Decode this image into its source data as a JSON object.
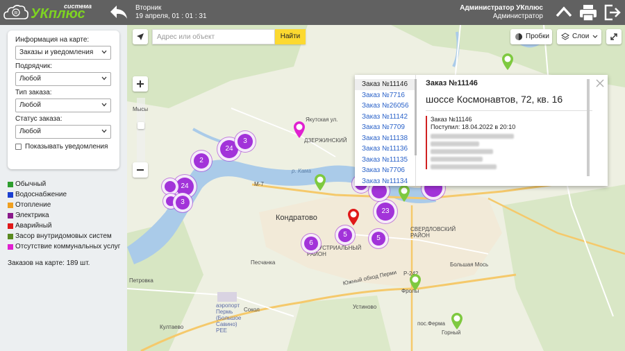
{
  "header": {
    "logo_top": "система",
    "logo_main": "УКплюс",
    "weekday": "Вторник",
    "datetime": "19 апреля, 01 : 01 : 31",
    "user_name": "Администратор УКплюс",
    "user_role": "Администратор"
  },
  "filters": {
    "info_label": "Информация на карте:",
    "info_value": "Заказы и уведомления",
    "contractor_label": "Подрядчик:",
    "contractor_value": "Любой",
    "type_label": "Тип заказа:",
    "type_value": "Любой",
    "status_label": "Статус заказа:",
    "status_value": "Любой",
    "show_notifications": "Показывать уведомления"
  },
  "legend": [
    {
      "label": "Обычный",
      "color": "#2e9e2e"
    },
    {
      "label": "Водоснабжение",
      "color": "#1a3fd1"
    },
    {
      "label": "Отопление",
      "color": "#f0a020"
    },
    {
      "label": "Электрика",
      "color": "#8a1a8a"
    },
    {
      "label": "Аварийный",
      "color": "#e01818"
    },
    {
      "label": "Засор внутридомовых систем",
      "color": "#5a8a20"
    },
    {
      "label": "Отсутствие коммунальных услуг",
      "color": "#e020d0"
    }
  ],
  "orders_count": "Заказов на карте: 189 шт.",
  "map": {
    "search_placeholder": "Адрес или объект",
    "search_button": "Найти",
    "traffic": "Пробки",
    "layers": "Слои",
    "places": {
      "mysy": "Мысы",
      "yakutskaya": "Якутская ул.",
      "dzerzhinsky": "ДЗЕРЖИНСКИЙ",
      "kama": "р. Кама",
      "m7": "М-7",
      "kondratovo": "Кондратово",
      "industrial": "ИНДУСТРИАЛЬНЫЙ РАЙОН",
      "sverdlovsky": "СВЕРДЛОВСКИЙ РАЙОН",
      "peschanka": "Песчанка",
      "bolshaya_mos": "Большая Мось",
      "petrovka": "Петровка",
      "sokol": "Сокол",
      "ustinovo": "Устиново",
      "airport": "аэропорт Пермь (Большое Савино) PEE",
      "kultaevo": "Култаево",
      "frolyi": "Фролы",
      "pos_ferma": "пос.Ферма",
      "gorny": "Горный",
      "southern_bypass": "Южный обход Перми",
      "r242": "Р-242"
    },
    "clusters": [
      "24",
      "3",
      "2",
      "24",
      "3",
      "23",
      "5",
      "5",
      "6",
      "5"
    ]
  },
  "popup": {
    "orders": [
      "Заказ №11146",
      "Заказ №7716",
      "Заказ №26056",
      "Заказ №11142",
      "Заказ №7709",
      "Заказ №11138",
      "Заказ №11136",
      "Заказ №11135",
      "Заказ №7706",
      "Заказ №11134"
    ],
    "title": "Заказ №11146",
    "address": "шоссе Космонавтов, 72, кв. 16",
    "detail_order": "Заказ №11146",
    "received": "Поступил: 18.04.2022 в 20:10"
  }
}
